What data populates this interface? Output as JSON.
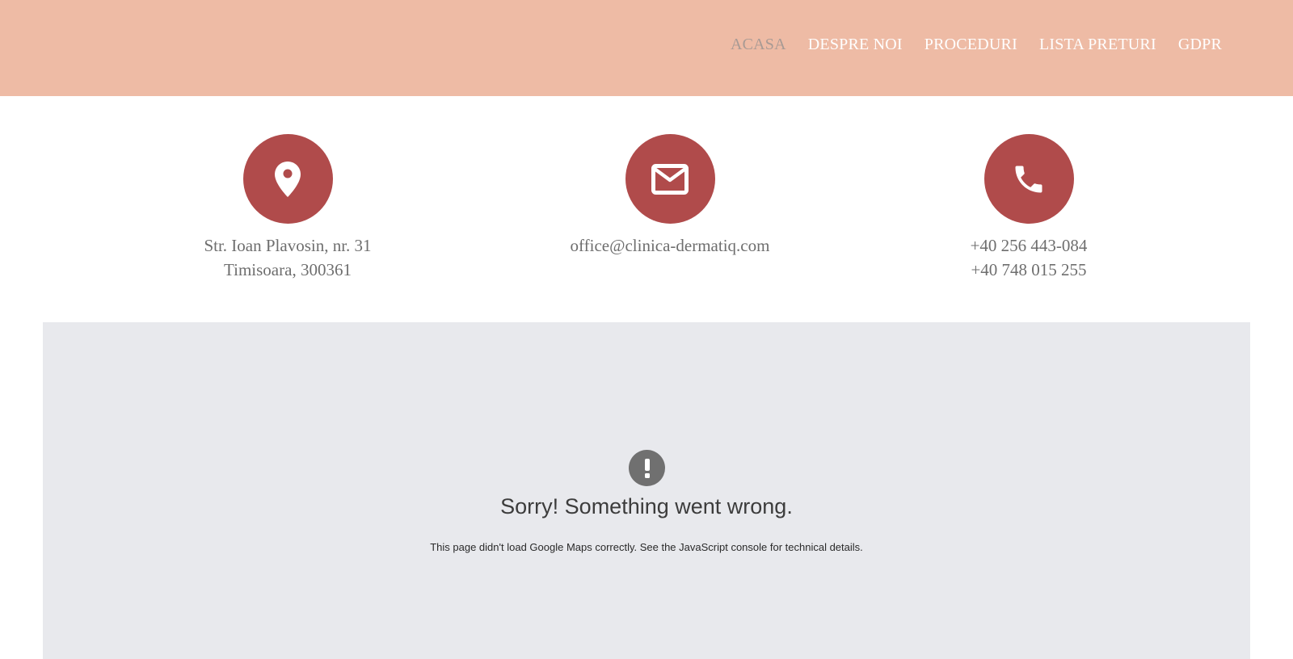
{
  "nav": {
    "items": [
      {
        "label": "ACASA",
        "active": true
      },
      {
        "label": "DESPRE NOI"
      },
      {
        "label": "PROCEDURI"
      },
      {
        "label": "LISTA PRETURI"
      },
      {
        "label": "GDPR"
      }
    ]
  },
  "contact": {
    "address": {
      "icon": "location-pin-icon",
      "line1": "Str. Ioan Plavosin, nr. 31",
      "line2": "Timisoara, 300361"
    },
    "email": {
      "icon": "envelope-icon",
      "line1": "office@clinica-dermatiq.com"
    },
    "phone": {
      "icon": "phone-icon",
      "line1": "+40 256 443-084",
      "line2": "+40 748 015 255"
    }
  },
  "map": {
    "error_icon": "exclamation-icon",
    "error_title": "Sorry! Something went wrong.",
    "error_message": "This page didn't load Google Maps correctly. See the JavaScript console for technical details."
  },
  "colors": {
    "header_bg": "#eebba5",
    "accent": "#b04b4b",
    "nav_active": "#a89a94",
    "map_bg": "#e8e9ed"
  }
}
